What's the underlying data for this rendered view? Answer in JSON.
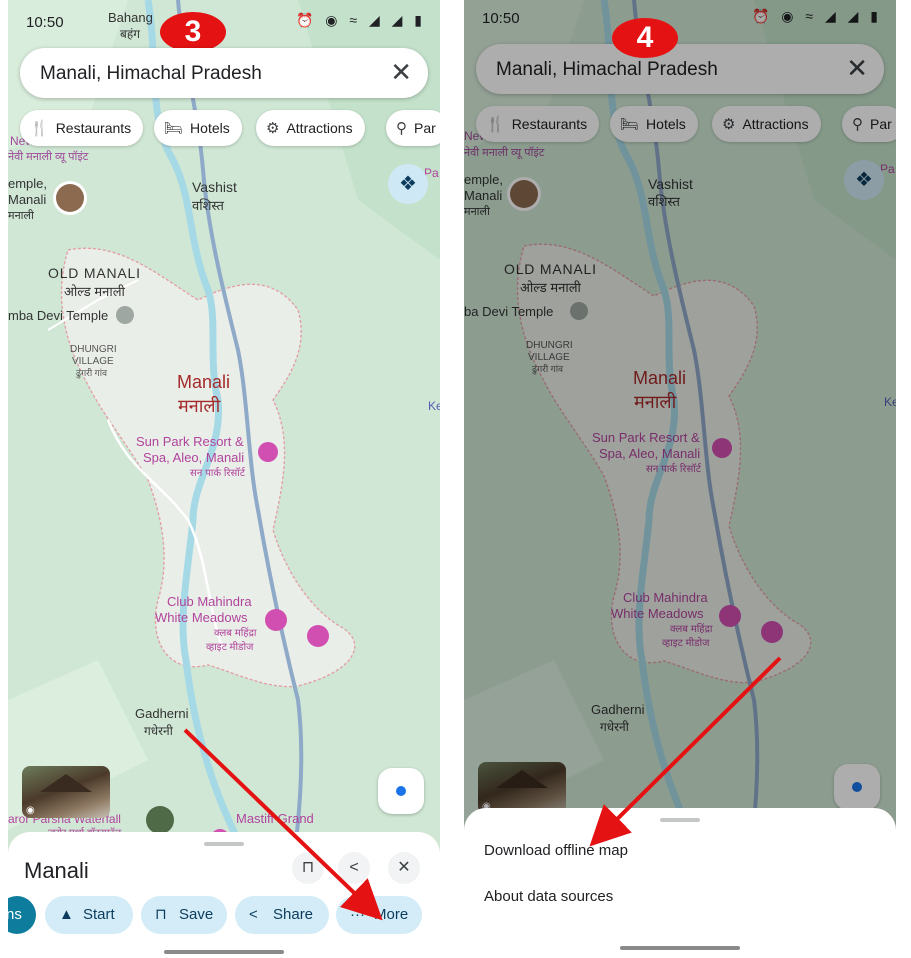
{
  "colors": {
    "accent": "#1a73e8",
    "callout": "#e41212",
    "chip_bg": "#d3ecf7",
    "map_green": "#cfe7d4"
  },
  "status": {
    "time": "10:50"
  },
  "search": {
    "query": "Manali, Himachal Pradesh",
    "clear_icon": "close-icon"
  },
  "chips": [
    {
      "label": "Restaurants",
      "icon": "fork-knife-icon"
    },
    {
      "label": "Hotels",
      "icon": "bed-icon"
    },
    {
      "label": "Attractions",
      "icon": "camera-icon"
    },
    {
      "label": "Par",
      "icon": "tree-icon"
    }
  ],
  "map_labels": {
    "bahang": "Bahang",
    "bahang_hi": "बहंग",
    "vashist": "Vashist",
    "vashist_hi": "वशिस्त",
    "new": "New",
    "new_sub": "नेवी मनाली व्यू पॉइंट",
    "temple": "emple,",
    "temple2": "Manali",
    "temple3": "मनाली",
    "old_manali": "OLD MANALI",
    "old_manali_hi": "ओल्ड मनाली",
    "hadimba": "mba Devi Temple",
    "hadimba_right": "ba Devi Temple",
    "dhungri": "DHUNGRI",
    "village": "VILLAGE",
    "village_hi": "ढुंगरी गांव",
    "manali": "Manali",
    "manali_hi": "मनाली",
    "sunpark1": "Sun Park Resort &",
    "sunpark2": "Spa, Aleo, Manali",
    "sunpark_hi": "सन पार्क रिसॉर्ट",
    "club1": "Club Mahindra",
    "club2": "White Meadows",
    "club_hi1": "क्लब महिंद्रा",
    "club_hi2": "व्हाइट मीडोज",
    "gadherni": "Gadherni",
    "gadherni_hi": "गधेरनी",
    "parsha": "aror Parsha Waterfall",
    "parsha_hi": "जरोर पर्शा वॉटरफॉल",
    "mastiff": "Mastiff Grand",
    "pa": "Pa",
    "ke": "Ke"
  },
  "callouts": {
    "left": "3",
    "right": "4"
  },
  "sheet": {
    "title": "Manali",
    "actions": [
      {
        "label": "ns",
        "icon": ""
      },
      {
        "label": "Start",
        "icon": "navigation-arrow-icon"
      },
      {
        "label": "Save",
        "icon": "bookmark-icon"
      },
      {
        "label": "Share",
        "icon": "share-icon"
      },
      {
        "label": "More",
        "icon": "more-horizontal-icon"
      }
    ]
  },
  "menu": {
    "items": [
      "Download offline map",
      "About data sources"
    ]
  }
}
